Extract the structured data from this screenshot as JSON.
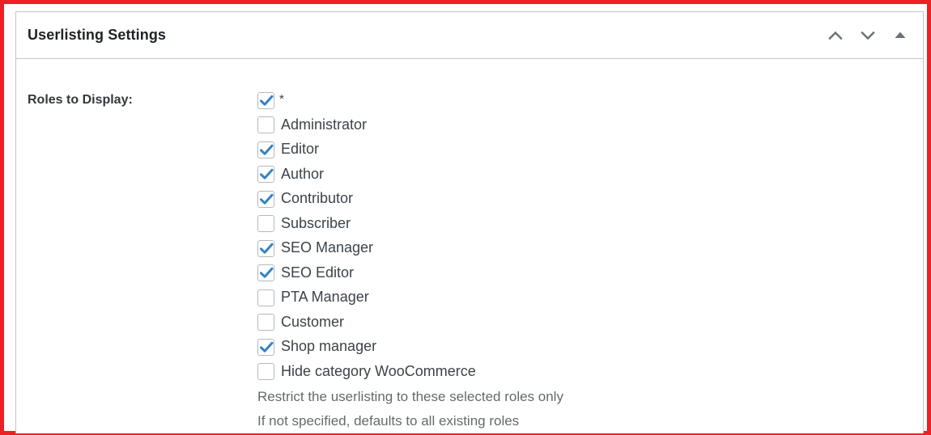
{
  "panel": {
    "title": "Userlisting Settings",
    "actions": [
      {
        "name": "move-up-button",
        "icon": "chevron-up-icon"
      },
      {
        "name": "move-down-button",
        "icon": "chevron-down-icon"
      },
      {
        "name": "toggle-panel-button",
        "icon": "triangle-up-icon"
      }
    ]
  },
  "field": {
    "label": "Roles to Display:",
    "options": [
      {
        "label": "*",
        "checked": true
      },
      {
        "label": "Administrator",
        "checked": false
      },
      {
        "label": "Editor",
        "checked": true
      },
      {
        "label": "Author",
        "checked": true
      },
      {
        "label": "Contributor",
        "checked": true
      },
      {
        "label": "Subscriber",
        "checked": false
      },
      {
        "label": "SEO Manager",
        "checked": true
      },
      {
        "label": "SEO Editor",
        "checked": true
      },
      {
        "label": "PTA Manager",
        "checked": false
      },
      {
        "label": "Customer",
        "checked": false
      },
      {
        "label": "Shop manager",
        "checked": true
      },
      {
        "label": "Hide category WooCommerce",
        "checked": false
      }
    ],
    "help": [
      "Restrict the userlisting to these selected roles only",
      "If not specified, defaults to all existing roles"
    ]
  },
  "colors": {
    "highlight_border": "#ed2024",
    "panel_border": "#c3c4c7",
    "title_text": "#1d2327",
    "label_text": "#32373c",
    "option_text": "#3c434a",
    "help_text": "#646970",
    "check_blue": "#3582c4",
    "icon_gray": "#6c7078"
  }
}
